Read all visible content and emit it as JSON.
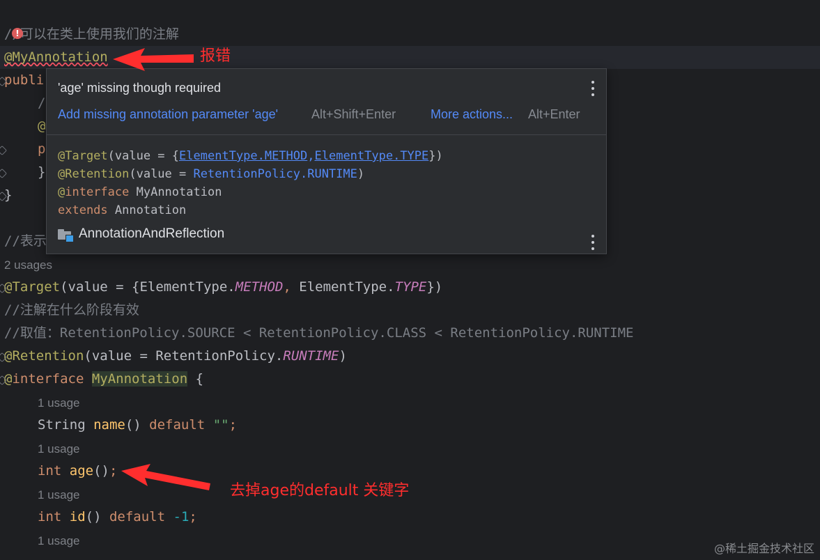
{
  "editor": {
    "comment1": "//可以在类上使用我们的注解",
    "ann_line": "@MyAnnotation",
    "public_partial": "publi",
    "slash_partial": "/",
    "at_partial": "@",
    "p_partial": "p",
    "brace_partial": "}",
    "brace_close": "}",
    "comment2_partial": "//表示",
    "usages_class": "2 usages",
    "target_prefix": "@Target",
    "target_mid": "(value = {ElementType.",
    "target_method": "METHOD",
    "target_comma": ", ",
    "target_et": "ElementType.",
    "target_type": "TYPE",
    "target_end": "})",
    "comment3": "//注解在什么阶段有效",
    "comment4": "//取值：RetentionPolicy.SOURCE < RetentionPolicy.CLASS < RetentionPolicy.RUNTIME",
    "retention_prefix": "@Retention",
    "retention_mid": "(value = RetentionPolicy.",
    "retention_runtime": "RUNTIME",
    "retention_end": ")",
    "interface_at": "@",
    "interface_kw": "interface",
    "interface_name": "MyAnnotation",
    "interface_brace": " {",
    "usage1": "1 usage",
    "name_type": "String ",
    "name_fn": "name",
    "name_rest": "() ",
    "name_default": "default",
    "name_value": " \"\"",
    "name_semi": ";",
    "usage2": "1 usage",
    "age_type": "int",
    "age_fn": " age",
    "age_rest": "()",
    "age_semi": ";",
    "usage3": "1 usage",
    "id_type": "int",
    "id_fn": " id",
    "id_rest": "() ",
    "id_default": "default",
    "id_num": " -1",
    "id_semi": ";",
    "usage4": "1 usage"
  },
  "popup": {
    "message": "'age' missing though required",
    "fix_label": "Add missing annotation parameter 'age'",
    "fix_shortcut": "Alt+Shift+Enter",
    "more_label": "More actions...",
    "more_shortcut": "Alt+Enter",
    "code": {
      "l1_ann": "@Target",
      "l1_a": "(value = {",
      "l1_link1": "ElementType.METHOD",
      "l1_sep": ",",
      "l1_link2": "ElementType.TYPE",
      "l1_end": "})",
      "l2_ann": "@Retention",
      "l2_a": "(value = ",
      "l2_val": "RetentionPolicy.RUNTIME",
      "l2_end": ")",
      "l3_at": "@",
      "l3_kw": "interface",
      "l3_name": " MyAnnotation",
      "l4_kw": "extends",
      "l4_name": " Annotation"
    },
    "module": "AnnotationAndReflection"
  },
  "annotations": {
    "error_note": "报错",
    "fix_note": "去掉age的default 关键字"
  },
  "watermark": "@稀土掘金技术社区",
  "colors": {
    "background": "#1e1f22",
    "annotation_red": "#ff2e2e",
    "link_blue": "#548af7"
  }
}
